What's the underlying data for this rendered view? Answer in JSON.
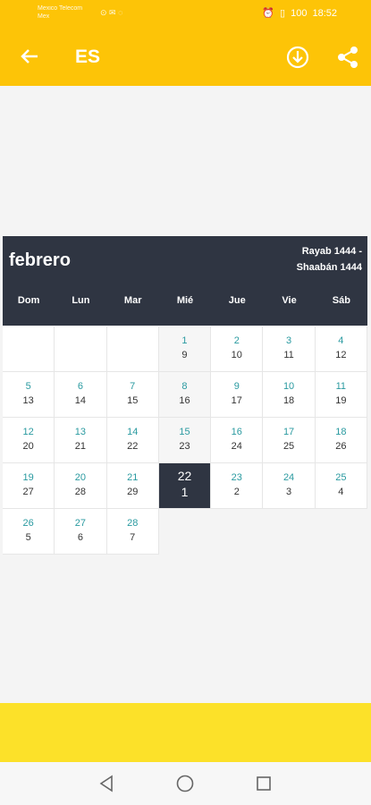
{
  "status_bar": {
    "carrier_line1": "Mexico Telecom",
    "carrier_line2": "Mex",
    "battery": "100",
    "time": "18:52"
  },
  "app_bar": {
    "title": "ES",
    "back_icon": "arrow-left-icon",
    "download_icon": "download-icon",
    "share_icon": "share-icon"
  },
  "calendar": {
    "month": "febrero",
    "hijri_line1": "Rayab 1444 -",
    "hijri_line2": "Shaabán 1444",
    "weekdays": [
      "Dom",
      "Lun",
      "Mar",
      "Mié",
      "Jue",
      "Vie",
      "Sáb"
    ],
    "weeks": [
      [
        null,
        null,
        null,
        {
          "g": "1",
          "h": "9"
        },
        {
          "g": "2",
          "h": "10"
        },
        {
          "g": "3",
          "h": "11"
        },
        {
          "g": "4",
          "h": "12"
        }
      ],
      [
        {
          "g": "5",
          "h": "13"
        },
        {
          "g": "6",
          "h": "14"
        },
        {
          "g": "7",
          "h": "15"
        },
        {
          "g": "8",
          "h": "16"
        },
        {
          "g": "9",
          "h": "17"
        },
        {
          "g": "10",
          "h": "18"
        },
        {
          "g": "11",
          "h": "19"
        }
      ],
      [
        {
          "g": "12",
          "h": "20"
        },
        {
          "g": "13",
          "h": "21"
        },
        {
          "g": "14",
          "h": "22"
        },
        {
          "g": "15",
          "h": "23"
        },
        {
          "g": "16",
          "h": "24"
        },
        {
          "g": "17",
          "h": "25"
        },
        {
          "g": "18",
          "h": "26"
        }
      ],
      [
        {
          "g": "19",
          "h": "27"
        },
        {
          "g": "20",
          "h": "28"
        },
        {
          "g": "21",
          "h": "29"
        },
        {
          "g": "22",
          "h": "1",
          "today": true
        },
        {
          "g": "23",
          "h": "2"
        },
        {
          "g": "24",
          "h": "3"
        },
        {
          "g": "25",
          "h": "4"
        }
      ],
      [
        {
          "g": "26",
          "h": "5"
        },
        {
          "g": "27",
          "h": "6"
        },
        {
          "g": "28",
          "h": "7"
        }
      ]
    ]
  },
  "colors": {
    "accent": "#fdc407",
    "header_dark": "#2f3542",
    "gregorian_text": "#2a9aa0"
  },
  "nav": {
    "back_icon": "triangle-back-icon",
    "home_icon": "circle-home-icon",
    "recents_icon": "square-recents-icon"
  }
}
